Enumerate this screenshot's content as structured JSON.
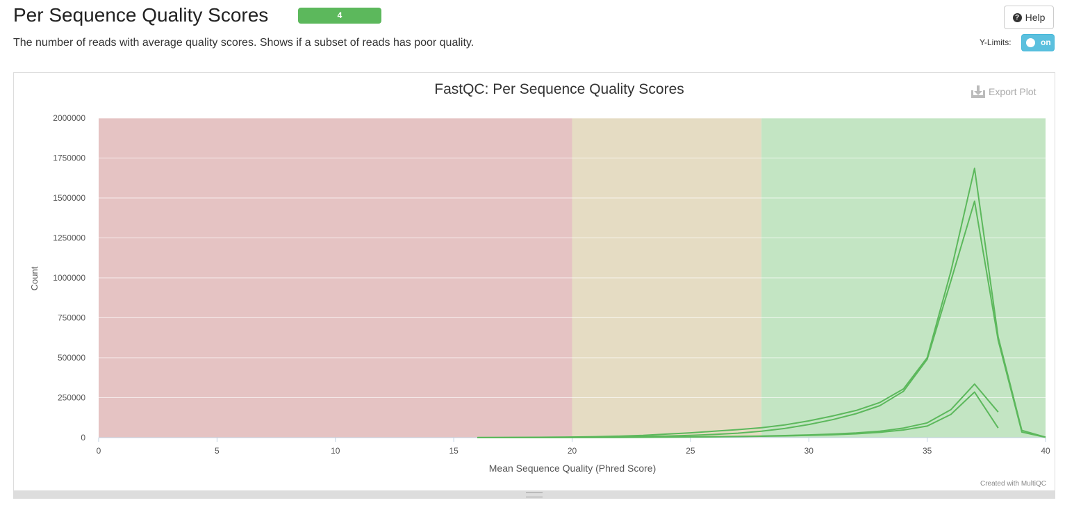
{
  "header": {
    "title": "Per Sequence Quality Scores",
    "badge": "4",
    "help_label": "Help",
    "description": "The number of reads with average quality scores. Shows if a subset of reads has poor quality."
  },
  "controls": {
    "ylimits_label": "Y-Limits:",
    "ylimits_toggle": "on"
  },
  "plot": {
    "export_label": "Export Plot",
    "credit": "Created with MultiQC"
  },
  "colors": {
    "line": "#5cb85c",
    "fail_band": "#e5c3c3",
    "warn_band": "#e5dcc3",
    "pass_band": "#c3e5c3",
    "badge": "#5cb85c",
    "toggle": "#5bc0de"
  },
  "chart_data": {
    "type": "line",
    "title": "FastQC: Per Sequence Quality Scores",
    "xlabel": "Mean Sequence Quality (Phred Score)",
    "ylabel": "Count",
    "xlim": [
      0,
      40
    ],
    "ylim": [
      0,
      2000000
    ],
    "xticks": [
      0,
      5,
      10,
      15,
      20,
      25,
      30,
      35,
      40
    ],
    "yticks": [
      0,
      250000,
      500000,
      750000,
      1000000,
      1250000,
      1500000,
      1750000,
      2000000
    ],
    "ytick_labels": [
      "0",
      "250000",
      "500000",
      "750000",
      "1000000",
      "1250000",
      "1500000",
      "1750000",
      "2000000"
    ],
    "grid": true,
    "legend": "none",
    "bands": [
      {
        "from": 0,
        "to": 20,
        "status": "fail"
      },
      {
        "from": 20,
        "to": 28,
        "status": "warn"
      },
      {
        "from": 28,
        "to": 40,
        "status": "pass"
      }
    ],
    "series": [
      {
        "x": [
          16,
          17,
          18,
          19,
          20,
          21,
          22,
          23,
          24,
          25,
          26,
          27,
          28,
          29,
          30,
          31,
          32,
          33,
          34,
          35,
          36,
          37,
          38,
          39,
          40
        ],
        "values": [
          500,
          1000,
          1500,
          2500,
          4000,
          6000,
          9000,
          14000,
          22000,
          30000,
          40000,
          50000,
          62000,
          80000,
          105000,
          135000,
          170000,
          220000,
          305000,
          500000,
          1040000,
          1685000,
          630000,
          45000,
          3000
        ]
      },
      {
        "x": [
          16,
          17,
          18,
          19,
          20,
          21,
          22,
          23,
          24,
          25,
          26,
          27,
          28,
          29,
          30,
          31,
          32,
          33,
          34,
          35,
          36,
          37,
          38,
          39,
          40
        ],
        "values": [
          300,
          600,
          1000,
          1500,
          2500,
          3500,
          5000,
          7000,
          10000,
          14000,
          20000,
          28000,
          40000,
          58000,
          82000,
          112000,
          150000,
          200000,
          290000,
          490000,
          980000,
          1480000,
          610000,
          35000,
          2000
        ]
      },
      {
        "x": [
          16,
          17,
          18,
          19,
          20,
          21,
          22,
          23,
          24,
          25,
          26,
          27,
          28,
          29,
          30,
          31,
          32,
          33,
          34,
          35,
          36,
          37,
          38
        ],
        "values": [
          100,
          200,
          300,
          500,
          800,
          1200,
          1800,
          2600,
          3600,
          4800,
          6200,
          7800,
          10000,
          13000,
          17000,
          22000,
          29000,
          40000,
          60000,
          92000,
          175000,
          335000,
          160000
        ]
      },
      {
        "x": [
          16,
          17,
          18,
          19,
          20,
          21,
          22,
          23,
          24,
          25,
          26,
          27,
          28,
          29,
          30,
          31,
          32,
          33,
          34,
          35,
          36,
          37,
          38
        ],
        "values": [
          80,
          150,
          250,
          400,
          600,
          900,
          1300,
          1900,
          2700,
          3700,
          5000,
          6500,
          8500,
          11000,
          14000,
          18000,
          24000,
          33000,
          48000,
          72000,
          145000,
          285000,
          60000
        ]
      }
    ]
  }
}
